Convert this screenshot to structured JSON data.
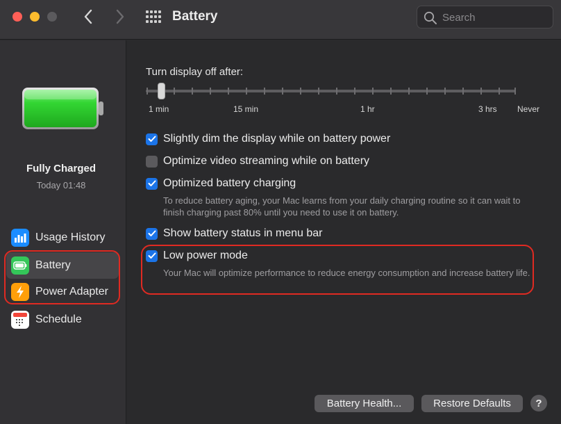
{
  "window": {
    "title": "Battery",
    "search_placeholder": "Search"
  },
  "sidebar": {
    "status_title": "Fully Charged",
    "status_time": "Today 01:48",
    "items": [
      {
        "label": "Usage History",
        "icon": "bar-chart-icon",
        "color": "#1a8cff"
      },
      {
        "label": "Battery",
        "icon": "battery-icon",
        "color": "#34c759"
      },
      {
        "label": "Power Adapter",
        "icon": "lightning-icon",
        "color": "#ff9f0a"
      },
      {
        "label": "Schedule",
        "icon": "calendar-icon",
        "color": "#ffffff"
      }
    ],
    "selected": "Battery"
  },
  "display_off": {
    "label": "Turn display off after:",
    "ticks": [
      "1 min",
      "15 min",
      "1 hr",
      "3 hrs",
      "Never"
    ],
    "value": "1 min"
  },
  "options": [
    {
      "label": "Slightly dim the display while on battery power",
      "checked": true
    },
    {
      "label": "Optimize video streaming while on battery",
      "checked": false
    },
    {
      "label": "Optimized battery charging",
      "checked": true,
      "description": "To reduce battery aging, your Mac learns from your daily charging routine so it can wait to finish charging past 80% until you need to use it on battery."
    },
    {
      "label": "Show battery status in menu bar",
      "checked": true
    },
    {
      "label": "Low power mode",
      "checked": true,
      "description": "Your Mac will optimize performance to reduce energy consumption and increase battery life."
    }
  ],
  "buttons": {
    "battery_health": "Battery Health...",
    "restore_defaults": "Restore Defaults",
    "help": "?"
  },
  "colors": {
    "accent": "#1b74e8",
    "highlight": "#e02a22",
    "battery_fill": "#33d633"
  }
}
